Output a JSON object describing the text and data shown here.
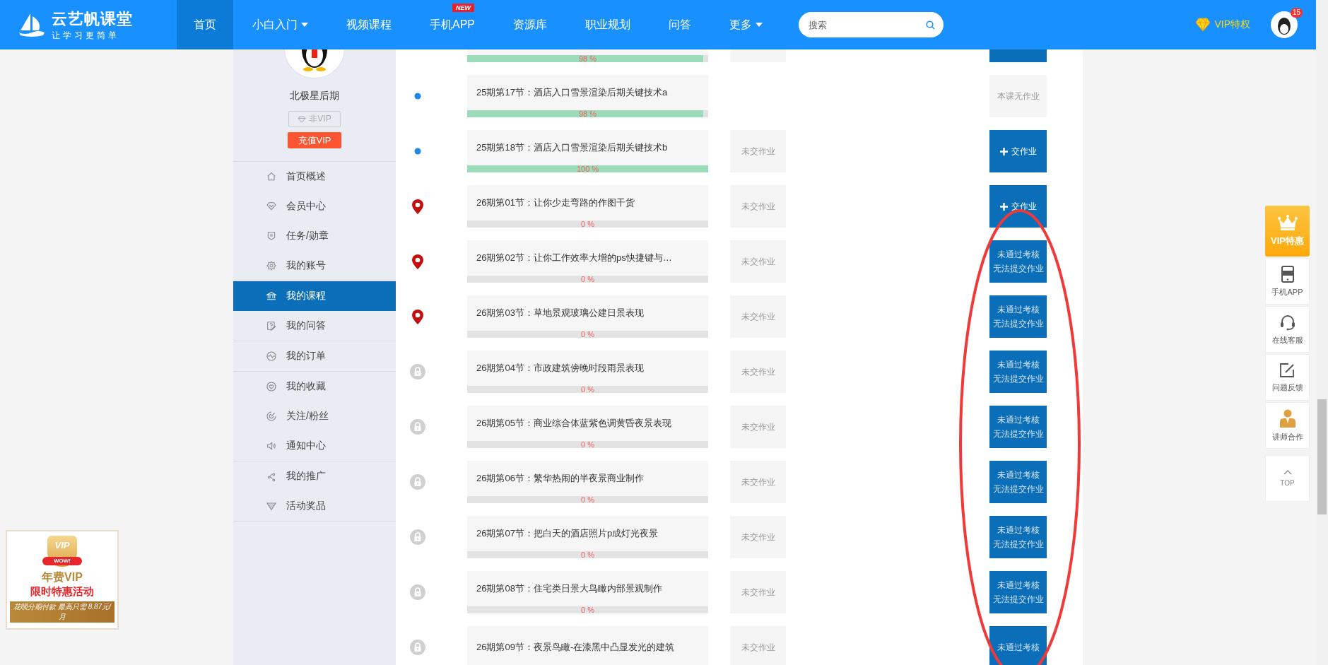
{
  "header": {
    "logo": {
      "title": "云艺帆课堂",
      "slogan": "让学习更简单"
    },
    "nav": [
      {
        "label": "首页",
        "selected": true
      },
      {
        "label": "小白入门",
        "selected": false,
        "dropdown": true
      },
      {
        "label": "视频课程",
        "selected": false
      },
      {
        "label": "手机APP",
        "selected": false,
        "badge": "NEW"
      },
      {
        "label": "资源库",
        "selected": false
      },
      {
        "label": "职业规划",
        "selected": false
      },
      {
        "label": "问答",
        "selected": false
      },
      {
        "label": "更多",
        "selected": false,
        "dropdown": true
      }
    ],
    "search": {
      "placeholder": "搜索"
    },
    "vip_link": "VIP特权",
    "notification_count": "15"
  },
  "sidebar": {
    "username": "北极星后期",
    "vip_status": "非VIP",
    "recharge_button": "充值VIP",
    "menu_groups": [
      [
        {
          "label": "首页概述",
          "selected": false
        },
        {
          "label": "会员中心",
          "selected": false
        },
        {
          "label": "任务/勋章",
          "selected": false
        },
        {
          "label": "我的账号",
          "selected": false
        }
      ],
      [
        {
          "label": "我的课程",
          "selected": true
        },
        {
          "label": "我的问答",
          "selected": false
        }
      ],
      [
        {
          "label": "我的订单",
          "selected": false
        }
      ],
      [
        {
          "label": "我的收藏",
          "selected": false
        },
        {
          "label": "关注/粉丝",
          "selected": false
        },
        {
          "label": "通知中心",
          "selected": false
        }
      ],
      [
        {
          "label": "我的推广",
          "selected": false
        },
        {
          "label": "活动奖品",
          "selected": false
        }
      ]
    ]
  },
  "lessons": [
    {
      "partial": true,
      "level": 0.98,
      "progress": "98 %",
      "action": {
        "kind": "blank"
      }
    },
    {
      "kind": "dot",
      "title": "25期第17节：酒店入口雪景渲染后期关键技术a",
      "level": 0.98,
      "progress": "98 %",
      "action": {
        "kind": "none",
        "lines": [
          "本课无作业"
        ]
      }
    },
    {
      "kind": "dot",
      "title": "25期第18节：酒店入口雪景渲染后期关键技术b",
      "level": 1,
      "progress": "100 %",
      "status": "未交作业",
      "action": {
        "kind": "submit",
        "lines": [
          "交作业"
        ]
      }
    },
    {
      "kind": "pin",
      "title": "26期第01节：让你少走弯路的作图干货",
      "level": 0,
      "progress": "0 %",
      "status": "未交作业",
      "action": {
        "kind": "submit",
        "lines": [
          "交作业"
        ]
      }
    },
    {
      "kind": "pin",
      "title": "26期第02节：让你工作效率大增的ps快捷键与…",
      "level": 0,
      "progress": "0 %",
      "status": "未交作业",
      "action": {
        "kind": "blocked",
        "lines": [
          "未通过考核",
          "无法提交作业"
        ]
      }
    },
    {
      "kind": "pin",
      "title": "26期第03节：草地景观玻璃公建日景表现",
      "level": 0,
      "progress": "0 %",
      "status": "未交作业",
      "action": {
        "kind": "blocked",
        "lines": [
          "未通过考核",
          "无法提交作业"
        ]
      }
    },
    {
      "kind": "lock",
      "title": "26期第04节：市政建筑傍晚时段雨景表现",
      "level": 0,
      "progress": "0 %",
      "status": "未交作业",
      "action": {
        "kind": "blocked",
        "lines": [
          "未通过考核",
          "无法提交作业"
        ]
      }
    },
    {
      "kind": "lock",
      "title": "26期第05节：商业综合体蓝紫色调黄昏夜景表现",
      "level": 0,
      "progress": "0 %",
      "status": "未交作业",
      "action": {
        "kind": "blocked",
        "lines": [
          "未通过考核",
          "无法提交作业"
        ]
      }
    },
    {
      "kind": "lock",
      "title": "26期第06节：繁华热闹的半夜景商业制作",
      "level": 0,
      "progress": "0 %",
      "status": "未交作业",
      "action": {
        "kind": "blocked",
        "lines": [
          "未通过考核",
          "无法提交作业"
        ]
      }
    },
    {
      "kind": "lock",
      "title": "26期第07节：把白天的酒店照片p成灯光夜景",
      "level": 0,
      "progress": "0 %",
      "status": "未交作业",
      "action": {
        "kind": "blocked",
        "lines": [
          "未通过考核",
          "无法提交作业"
        ]
      }
    },
    {
      "kind": "lock",
      "title": "26期第08节：住宅类日景大鸟瞰内部景观制作",
      "level": 0,
      "progress": "0 %",
      "status": "未交作业",
      "action": {
        "kind": "blocked",
        "lines": [
          "未通过考核",
          "无法提交作业"
        ]
      }
    },
    {
      "kind": "lock",
      "title": "26期第09节：夜景鸟瞰-在漆黑中凸显发光的建筑",
      "status": "未交作业",
      "action": {
        "kind": "blocked",
        "lines": [
          "未通过考核"
        ]
      }
    }
  ],
  "float_bar": [
    {
      "kind": "vip",
      "label": "VIP特惠"
    },
    {
      "kind": "tool",
      "label": "手机APP"
    },
    {
      "kind": "tool",
      "label": "在线客服"
    },
    {
      "kind": "tool",
      "label": "问题反馈"
    },
    {
      "kind": "tool",
      "label": "讲师合作"
    },
    {
      "kind": "top",
      "label": "TOP"
    }
  ],
  "promo": {
    "shield": "VIP",
    "badge": "WOW!",
    "title": "年费VIP",
    "subtitle": "限时特惠活动",
    "ribbon": "花呗分期付款 最高只需 8.87元/月"
  }
}
